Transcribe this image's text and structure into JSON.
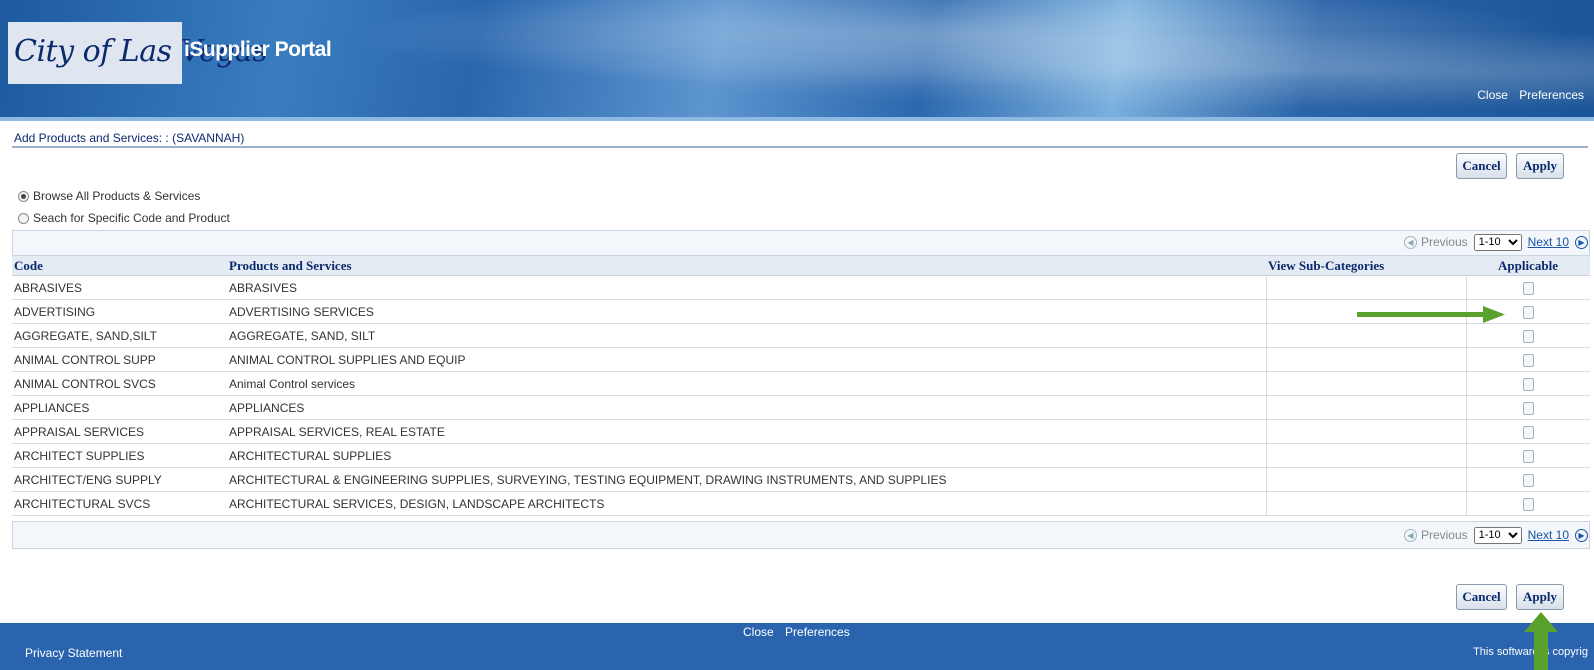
{
  "header": {
    "logo_text": "City of Las Vegas",
    "portal_title": "iSupplier Portal",
    "links": [
      "Close",
      "Preferences"
    ]
  },
  "page": {
    "title": "Add Products and Services: : (SAVANNAH)",
    "cancel_label": "Cancel",
    "apply_label": "Apply"
  },
  "options": {
    "browse_label": "Browse All Products & Services",
    "search_label": "Seach for Specific Code and Product",
    "selected": "browse"
  },
  "pager": {
    "previous_label": "Previous",
    "range_value": "1-10",
    "next_label": "Next 10"
  },
  "table": {
    "headers": [
      "Code",
      "Products and Services",
      "View Sub-Categories",
      "Applicable"
    ],
    "rows": [
      {
        "code": "ABRASIVES",
        "product": "ABRASIVES"
      },
      {
        "code": "ADVERTISING",
        "product": "ADVERTISING SERVICES"
      },
      {
        "code": "AGGREGATE, SAND,SILT",
        "product": "AGGREGATE, SAND, SILT"
      },
      {
        "code": "ANIMAL CONTROL SUPP",
        "product": "ANIMAL CONTROL SUPPLIES AND EQUIP"
      },
      {
        "code": "ANIMAL CONTROL SVCS",
        "product": "Animal Control services"
      },
      {
        "code": "APPLIANCES",
        "product": "APPLIANCES"
      },
      {
        "code": "APPRAISAL SERVICES",
        "product": "APPRAISAL SERVICES, REAL ESTATE"
      },
      {
        "code": "ARCHITECT SUPPLIES",
        "product": "ARCHITECTURAL SUPPLIES"
      },
      {
        "code": "ARCHITECT/ENG SUPPLY",
        "product": "ARCHITECTURAL & ENGINEERING SUPPLIES, SURVEYING, TESTING EQUIPMENT, DRAWING INSTRUMENTS, AND SUPPLIES"
      },
      {
        "code": "ARCHITECTURAL SVCS",
        "product": "ARCHITECTURAL SERVICES, DESIGN, LANDSCAPE ARCHITECTS"
      }
    ]
  },
  "footer": {
    "links": [
      "Close",
      "Preferences"
    ],
    "privacy": "Privacy Statement",
    "copyright": "This software is copyrig"
  },
  "annotations": {
    "arrow_color": "#5aa02c"
  }
}
